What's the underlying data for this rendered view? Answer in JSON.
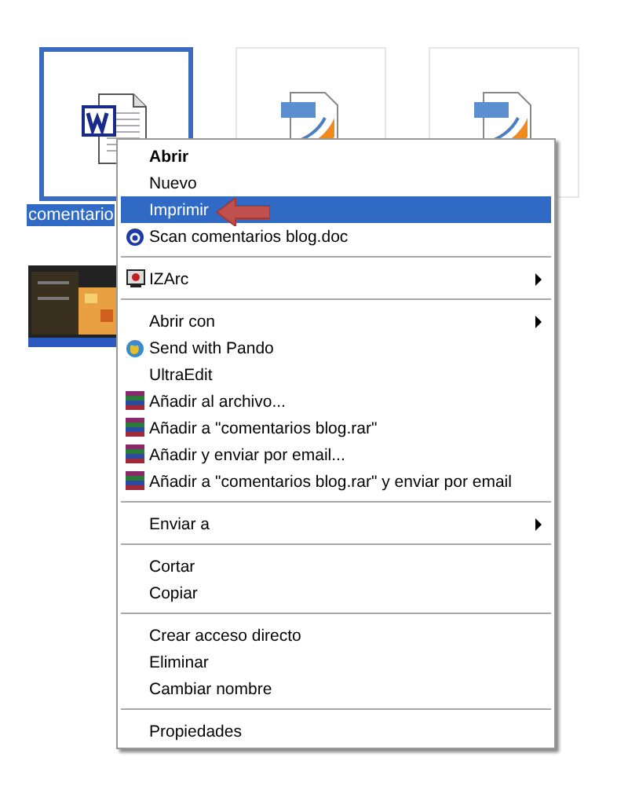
{
  "files": [
    {
      "kind": "word",
      "label": "comentario",
      "selected": true
    },
    {
      "kind": "pdf",
      "selected": false
    },
    {
      "kind": "pdf",
      "selected": false
    }
  ],
  "context_menu": {
    "items": [
      {
        "kind": "item",
        "label": "Abrir",
        "default": true,
        "selected": false,
        "submenu": false
      },
      {
        "kind": "item",
        "label": "Nuevo",
        "default": false,
        "selected": false,
        "submenu": false
      },
      {
        "kind": "item",
        "label": "Imprimir",
        "default": false,
        "selected": true,
        "submenu": false
      },
      {
        "kind": "item",
        "label": "Scan comentarios blog.doc",
        "default": false,
        "selected": false,
        "submenu": false
      },
      {
        "kind": "separator"
      },
      {
        "kind": "item",
        "label": "IZArc",
        "default": false,
        "selected": false,
        "submenu": true
      },
      {
        "kind": "separator"
      },
      {
        "kind": "item",
        "label": "Abrir con",
        "default": false,
        "selected": false,
        "submenu": true
      },
      {
        "kind": "item",
        "label": "Send with Pando",
        "default": false,
        "selected": false,
        "submenu": false
      },
      {
        "kind": "item",
        "label": "UltraEdit",
        "default": false,
        "selected": false,
        "submenu": false
      },
      {
        "kind": "item",
        "label": "Añadir al archivo...",
        "default": false,
        "selected": false,
        "submenu": false
      },
      {
        "kind": "item",
        "label": "Añadir a \"comentarios blog.rar\"",
        "default": false,
        "selected": false,
        "submenu": false
      },
      {
        "kind": "item",
        "label": "Añadir y enviar por email...",
        "default": false,
        "selected": false,
        "submenu": false
      },
      {
        "kind": "item",
        "label": "Añadir a \"comentarios blog.rar\" y enviar por email",
        "default": false,
        "selected": false,
        "submenu": false
      },
      {
        "kind": "separator"
      },
      {
        "kind": "item",
        "label": "Enviar a",
        "default": false,
        "selected": false,
        "submenu": true
      },
      {
        "kind": "separator"
      },
      {
        "kind": "item",
        "label": "Cortar",
        "default": false,
        "selected": false,
        "submenu": false
      },
      {
        "kind": "item",
        "label": "Copiar",
        "default": false,
        "selected": false,
        "submenu": false
      },
      {
        "kind": "separator"
      },
      {
        "kind": "item",
        "label": "Crear acceso directo",
        "default": false,
        "selected": false,
        "submenu": false
      },
      {
        "kind": "item",
        "label": "Eliminar",
        "default": false,
        "selected": false,
        "submenu": false
      },
      {
        "kind": "item",
        "label": "Cambiar nombre",
        "default": false,
        "selected": false,
        "submenu": false
      },
      {
        "kind": "separator"
      },
      {
        "kind": "item",
        "label": "Propiedades",
        "default": false,
        "selected": false,
        "submenu": false
      }
    ]
  }
}
